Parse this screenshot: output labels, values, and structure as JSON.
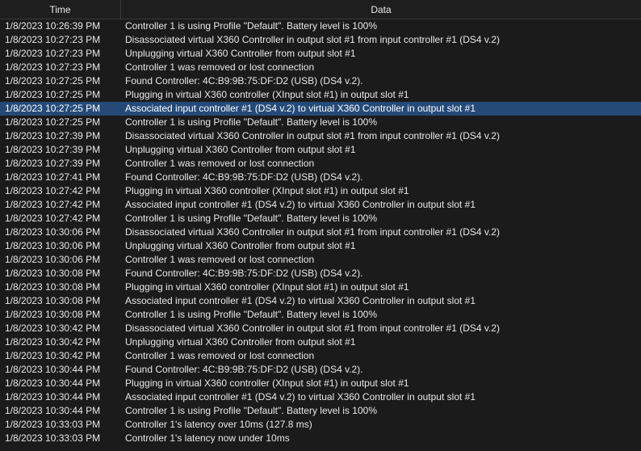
{
  "header": {
    "time_label": "Time",
    "data_label": "Data"
  },
  "log": [
    {
      "time": "1/8/2023 10:26:39 PM",
      "data": "Controller 1 is using Profile \"Default\". Battery level is 100%"
    },
    {
      "time": "1/8/2023 10:27:23 PM",
      "data": "Disassociated virtual X360 Controller in output slot #1 from input controller #1 (DS4 v.2)"
    },
    {
      "time": "1/8/2023 10:27:23 PM",
      "data": "Unplugging virtual X360 Controller from output slot #1"
    },
    {
      "time": "1/8/2023 10:27:23 PM",
      "data": "Controller 1 was removed or lost connection"
    },
    {
      "time": "1/8/2023 10:27:25 PM",
      "data": "Found Controller: 4C:B9:9B:75:DF:D2 (USB) (DS4 v.2)."
    },
    {
      "time": "1/8/2023 10:27:25 PM",
      "data": "Plugging in virtual X360 controller (XInput slot #1) in output slot #1"
    },
    {
      "time": "1/8/2023 10:27:25 PM",
      "data": "Associated input controller #1 (DS4 v.2) to virtual X360 Controller in output slot #1",
      "selected": true
    },
    {
      "time": "1/8/2023 10:27:25 PM",
      "data": "Controller 1 is using Profile \"Default\". Battery level is 100%"
    },
    {
      "time": "1/8/2023 10:27:39 PM",
      "data": "Disassociated virtual X360 Controller in output slot #1 from input controller #1 (DS4 v.2)"
    },
    {
      "time": "1/8/2023 10:27:39 PM",
      "data": "Unplugging virtual X360 Controller from output slot #1"
    },
    {
      "time": "1/8/2023 10:27:39 PM",
      "data": "Controller 1 was removed or lost connection"
    },
    {
      "time": "1/8/2023 10:27:41 PM",
      "data": "Found Controller: 4C:B9:9B:75:DF:D2 (USB) (DS4 v.2)."
    },
    {
      "time": "1/8/2023 10:27:42 PM",
      "data": "Plugging in virtual X360 controller (XInput slot #1) in output slot #1"
    },
    {
      "time": "1/8/2023 10:27:42 PM",
      "data": "Associated input controller #1 (DS4 v.2) to virtual X360 Controller in output slot #1"
    },
    {
      "time": "1/8/2023 10:27:42 PM",
      "data": "Controller 1 is using Profile \"Default\". Battery level is 100%"
    },
    {
      "time": "1/8/2023 10:30:06 PM",
      "data": "Disassociated virtual X360 Controller in output slot #1 from input controller #1 (DS4 v.2)"
    },
    {
      "time": "1/8/2023 10:30:06 PM",
      "data": "Unplugging virtual X360 Controller from output slot #1"
    },
    {
      "time": "1/8/2023 10:30:06 PM",
      "data": "Controller 1 was removed or lost connection"
    },
    {
      "time": "1/8/2023 10:30:08 PM",
      "data": "Found Controller: 4C:B9:9B:75:DF:D2 (USB) (DS4 v.2)."
    },
    {
      "time": "1/8/2023 10:30:08 PM",
      "data": "Plugging in virtual X360 controller (XInput slot #1) in output slot #1"
    },
    {
      "time": "1/8/2023 10:30:08 PM",
      "data": "Associated input controller #1 (DS4 v.2) to virtual X360 Controller in output slot #1"
    },
    {
      "time": "1/8/2023 10:30:08 PM",
      "data": "Controller 1 is using Profile \"Default\". Battery level is 100%"
    },
    {
      "time": "1/8/2023 10:30:42 PM",
      "data": "Disassociated virtual X360 Controller in output slot #1 from input controller #1 (DS4 v.2)"
    },
    {
      "time": "1/8/2023 10:30:42 PM",
      "data": "Unplugging virtual X360 Controller from output slot #1"
    },
    {
      "time": "1/8/2023 10:30:42 PM",
      "data": "Controller 1 was removed or lost connection"
    },
    {
      "time": "1/8/2023 10:30:44 PM",
      "data": "Found Controller: 4C:B9:9B:75:DF:D2 (USB) (DS4 v.2)."
    },
    {
      "time": "1/8/2023 10:30:44 PM",
      "data": "Plugging in virtual X360 controller (XInput slot #1) in output slot #1"
    },
    {
      "time": "1/8/2023 10:30:44 PM",
      "data": "Associated input controller #1 (DS4 v.2) to virtual X360 Controller in output slot #1"
    },
    {
      "time": "1/8/2023 10:30:44 PM",
      "data": "Controller 1 is using Profile \"Default\". Battery level is 100%"
    },
    {
      "time": "1/8/2023 10:33:03 PM",
      "data": "Controller 1's latency over 10ms (127.8 ms)"
    },
    {
      "time": "1/8/2023 10:33:03 PM",
      "data": "Controller 1's latency now under 10ms"
    }
  ],
  "colors": {
    "background": "#1b1b1b",
    "selected_row": "#254a78",
    "text": "#e8e8e8"
  }
}
